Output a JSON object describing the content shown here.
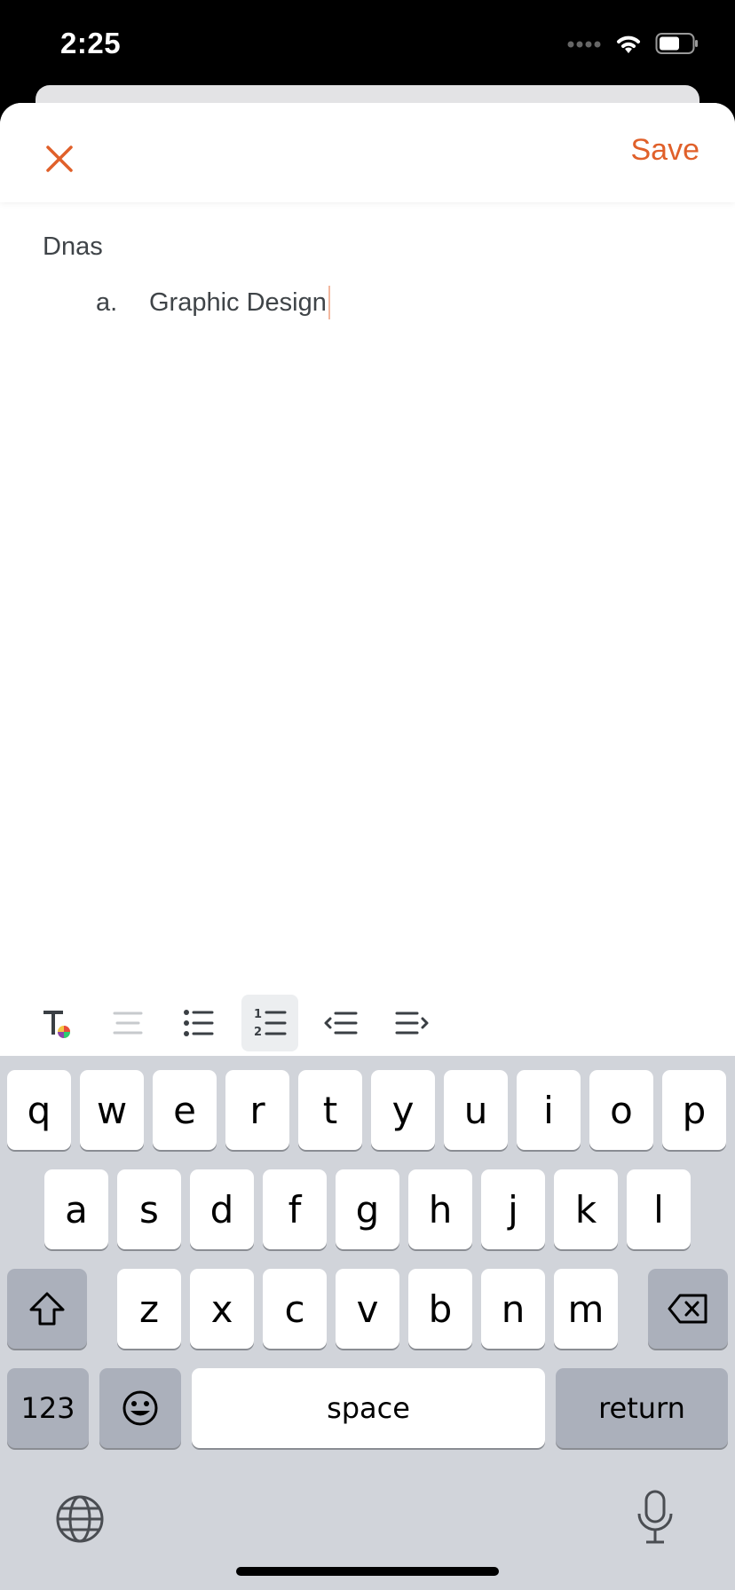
{
  "status": {
    "time": "2:25"
  },
  "nav": {
    "save_label": "Save"
  },
  "editor": {
    "line1": "Dnas",
    "list_item": {
      "marker": "a.",
      "text": "Graphic Design"
    }
  },
  "colors": {
    "accent": "#E0602A"
  },
  "toolbar": [
    {
      "name": "text-style-icon",
      "active": false
    },
    {
      "name": "align-icon",
      "active": false
    },
    {
      "name": "bullet-list-icon",
      "active": false
    },
    {
      "name": "numbered-list-icon",
      "active": true
    },
    {
      "name": "outdent-icon",
      "active": false
    },
    {
      "name": "indent-icon",
      "active": false
    }
  ],
  "keyboard": {
    "row1": [
      "q",
      "w",
      "e",
      "r",
      "t",
      "y",
      "u",
      "i",
      "o",
      "p"
    ],
    "row2": [
      "a",
      "s",
      "d",
      "f",
      "g",
      "h",
      "j",
      "k",
      "l"
    ],
    "row3": [
      "z",
      "x",
      "c",
      "v",
      "b",
      "n",
      "m"
    ],
    "numbers_label": "123",
    "space_label": "space",
    "return_label": "return"
  }
}
